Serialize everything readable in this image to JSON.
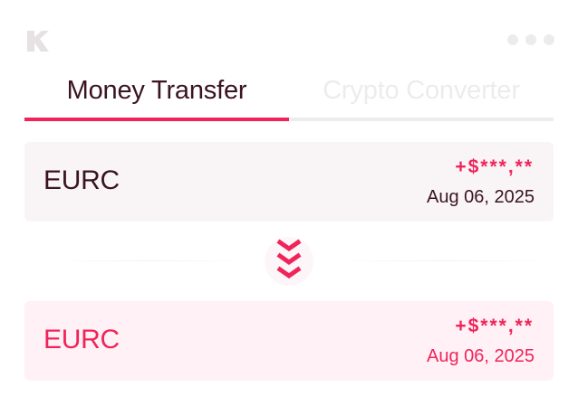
{
  "header": {
    "logo_icon": "brand-logo-icon",
    "window_controls_icon": "window-dots-icon"
  },
  "tabs": [
    {
      "label": "Money Transfer",
      "active": true
    },
    {
      "label": "Crypto Converter",
      "active": false
    }
  ],
  "from_card": {
    "currency": "EURC",
    "amount": "+$***,**",
    "date": "Aug 06, 2025"
  },
  "swap": {
    "icon": "double-chevron-down-icon"
  },
  "to_card": {
    "currency": "EURC",
    "amount": "+$***,**",
    "date": "Aug 06, 2025"
  },
  "colors": {
    "accent": "#f0245a",
    "text_dark": "#3a1420",
    "inactive": "#ececee",
    "card_from_bg": "#f9f5f7",
    "card_to_bg": "#fff1f5"
  }
}
